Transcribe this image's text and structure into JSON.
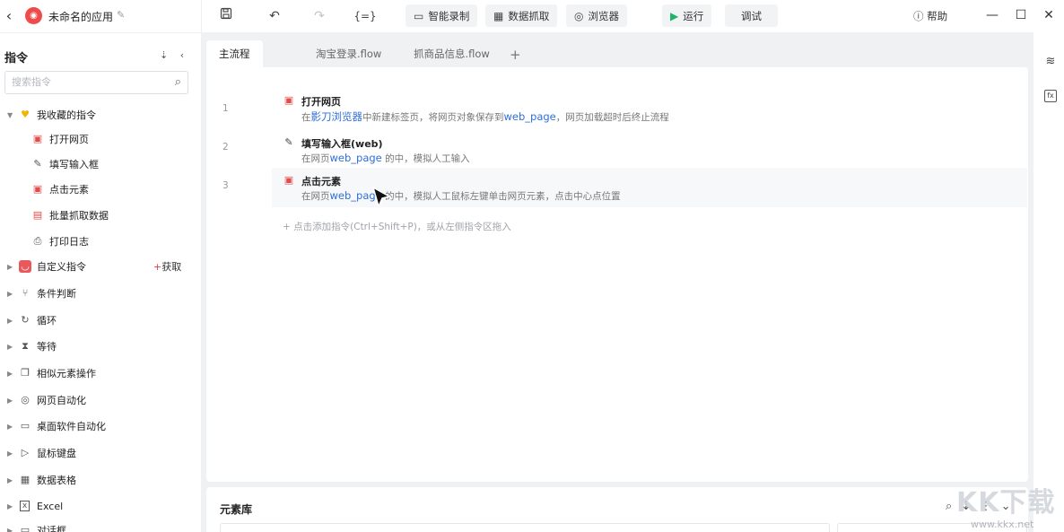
{
  "app": {
    "title": "未命名的应用"
  },
  "toolbar": {
    "smart_record": "智能录制",
    "data_grab": "数据抓取",
    "browser": "浏览器",
    "run": "运行",
    "debug": "调试",
    "help": "帮助",
    "variable_icon_text": "{=}"
  },
  "left": {
    "header": "指令",
    "search_placeholder": "搜索指令",
    "favorites_label": "我收藏的指令",
    "favorites": [
      "打开网页",
      "填写输入框",
      "点击元素",
      "批量抓取数据",
      "打印日志"
    ],
    "custom_label": "自定义指令",
    "get_label": "获取",
    "categories": [
      "条件判断",
      "循环",
      "等待",
      "相似元素操作",
      "网页自动化",
      "桌面软件自动化",
      "鼠标键盘",
      "数据表格",
      "Excel",
      "对话框"
    ]
  },
  "tabs": [
    "主流程",
    "淘宝登录.flow",
    "抓商品信息.flow"
  ],
  "steps": [
    {
      "no": "1",
      "title": "打开网页",
      "desc_prefix": "在",
      "desc_hl1": "影刀浏览器",
      "desc_mid": "中新建标签页，将网页对象保存到",
      "desc_hl2": "web_page",
      "desc_suffix": "，网页加载超时后终止流程"
    },
    {
      "no": "2",
      "title": "填写输入框(web)",
      "desc_prefix": "在网页",
      "desc_hl1": "web_page",
      "desc_suffix": " 的中，模拟人工输入"
    },
    {
      "no": "3",
      "title": "点击元素",
      "desc_prefix": "在网页",
      "desc_hl1": "web_page",
      "desc_suffix": " 的中，模拟人工鼠标左键单击网页元素，点击中心点位置"
    }
  ],
  "add_hint": "+ 点击添加指令(Ctrl+Shift+P)，或从左侧指令区拖入",
  "element_library": {
    "title": "元素库"
  },
  "watermark": {
    "text": "KK下载",
    "url": "www.kkx.net"
  },
  "colors": {
    "accent": "#2f6fdb",
    "run_green": "#21b36b",
    "logo_red": "#ef4b4b"
  }
}
